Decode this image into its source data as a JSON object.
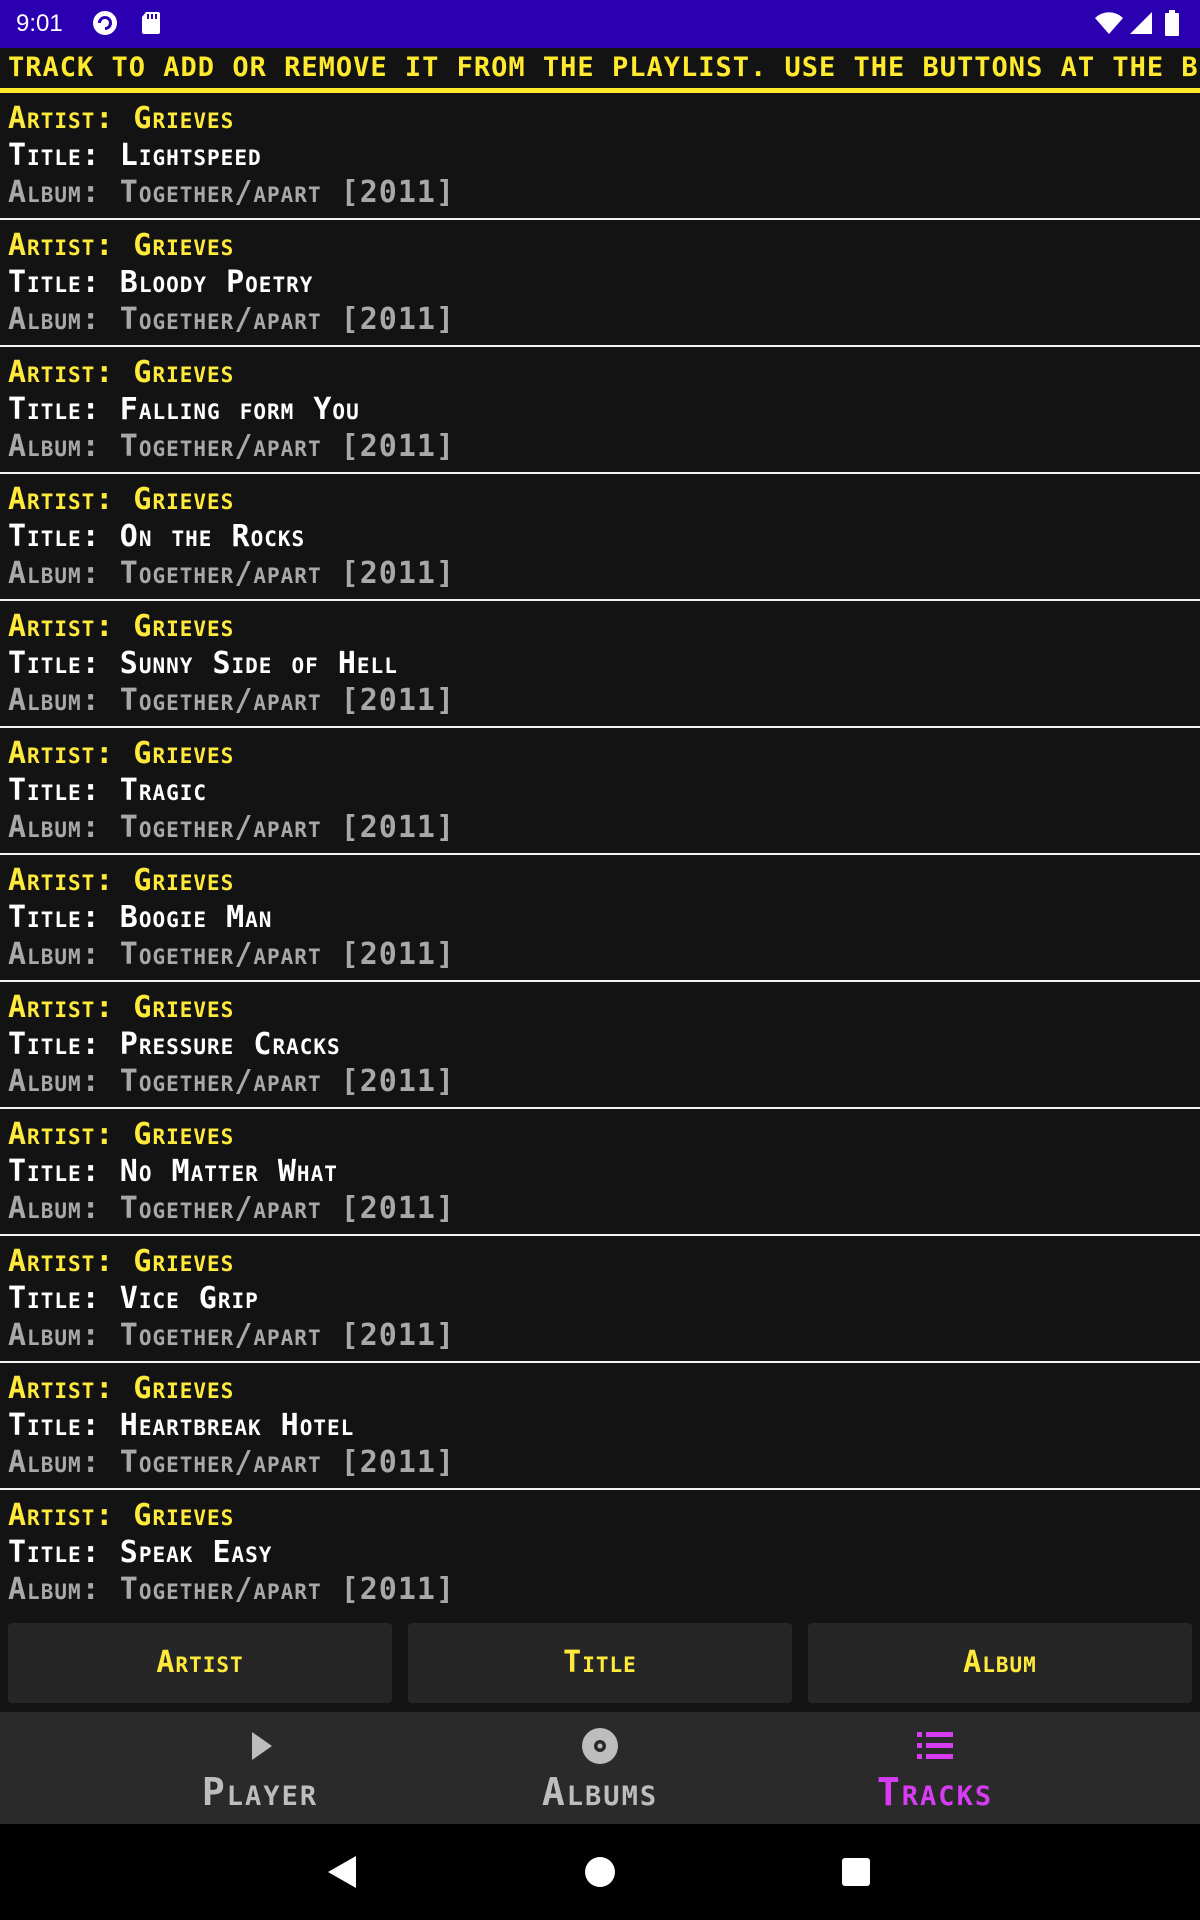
{
  "status_bar": {
    "time": "9:01",
    "left_icons": [
      "pocket-casts-icon",
      "sd-card-icon"
    ],
    "right_icons": [
      "wifi-icon",
      "cellular-icon",
      "battery-icon"
    ]
  },
  "marquee_text": "track to add or remove it from the playlist. Use the buttons at the b",
  "tracks": [
    {
      "artist": "Artist: Grieves",
      "title": "Title: Lightspeed",
      "album": "Album: Together/apart [2011]"
    },
    {
      "artist": "Artist: Grieves",
      "title": "Title: Bloody Poetry",
      "album": "Album: Together/apart [2011]"
    },
    {
      "artist": "Artist: Grieves",
      "title": "Title: Falling form You",
      "album": "Album: Together/apart [2011]"
    },
    {
      "artist": "Artist: Grieves",
      "title": "Title: On the Rocks",
      "album": "Album: Together/apart [2011]"
    },
    {
      "artist": "Artist: Grieves",
      "title": "Title: Sunny Side of Hell",
      "album": "Album: Together/apart [2011]"
    },
    {
      "artist": "Artist: Grieves",
      "title": "Title: Tragic",
      "album": "Album: Together/apart [2011]"
    },
    {
      "artist": "Artist: Grieves",
      "title": "Title: Boogie Man",
      "album": "Album: Together/apart [2011]"
    },
    {
      "artist": "Artist: Grieves",
      "title": "Title: Pressure Cracks",
      "album": "Album: Together/apart [2011]"
    },
    {
      "artist": "Artist: Grieves",
      "title": "Title: No Matter What",
      "album": "Album: Together/apart [2011]"
    },
    {
      "artist": "Artist: Grieves",
      "title": "Title: Vice Grip",
      "album": "Album: Together/apart [2011]"
    },
    {
      "artist": "Artist: Grieves",
      "title": "Title: Heartbreak Hotel",
      "album": "Album: Together/apart [2011]"
    },
    {
      "artist": "Artist: Grieves",
      "title": "Title: Speak Easy",
      "album": "Album: Together/apart [2011]"
    }
  ],
  "sort_buttons": {
    "artist": "Artist",
    "title": "Title",
    "album": "Album"
  },
  "bottom_nav": {
    "player": {
      "label": "Player",
      "icon": "play-icon"
    },
    "albums": {
      "label": "Albums",
      "icon": "disc-icon"
    },
    "tracks": {
      "label": "Tracks",
      "icon": "list-icon"
    }
  },
  "colors": {
    "status_bar": "#2b00b0",
    "accent_yellow": "#ffea3c",
    "active_tab": "#d83cf2",
    "inactive_tab": "#bdbdbd"
  }
}
